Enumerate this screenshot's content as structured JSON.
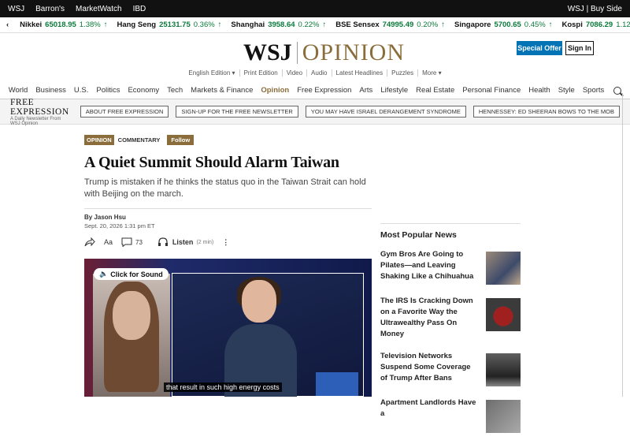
{
  "topbar": {
    "brands": [
      "WSJ",
      "Barron's",
      "MarketWatch",
      "IBD"
    ],
    "right": "WSJ | Buy Side"
  },
  "ticker": [
    {
      "name": "Nikkei",
      "value": "65018.95",
      "pct": "1.38%"
    },
    {
      "name": "Hang Seng",
      "value": "25131.75",
      "pct": "0.36%"
    },
    {
      "name": "Shanghai",
      "value": "3958.64",
      "pct": "0.22%"
    },
    {
      "name": "BSE Sensex",
      "value": "74995.49",
      "pct": "0.20%"
    },
    {
      "name": "Singapore",
      "value": "5700.65",
      "pct": "0.45%"
    },
    {
      "name": "Kospi",
      "value": "7086.29",
      "pct": "1.12%"
    }
  ],
  "header": {
    "logo_wsj": "WSJ",
    "logo_section": "OPINION",
    "special_offer": "Special Offer",
    "sign_in": "Sign In"
  },
  "subnav": [
    "English Edition ▾",
    "Print Edition",
    "Video",
    "Audio",
    "Latest Headlines",
    "Puzzles",
    "More ▾"
  ],
  "mainnav": [
    "World",
    "Business",
    "U.S.",
    "Politics",
    "Economy",
    "Tech",
    "Markets & Finance",
    "Opinion",
    "Free Expression",
    "Arts",
    "Lifestyle",
    "Real Estate",
    "Personal Finance",
    "Health",
    "Style",
    "Sports"
  ],
  "free_expression": {
    "title": "FREE EXPRESSION",
    "subtitle": "A Daily Newsletter From WSJ Opinion",
    "links": [
      "ABOUT FREE EXPRESSION",
      "SIGN-UP FOR THE FREE NEWSLETTER",
      "YOU MAY HAVE ISRAEL DERANGEMENT SYNDROME",
      "HENNESSEY: ED SHEERAN BOWS TO THE MOB"
    ]
  },
  "article": {
    "tag_opinion": "OPINION",
    "tag_commentary": "COMMENTARY",
    "follow": "Follow",
    "headline": "A Quiet Summit Should Alarm Taiwan",
    "dek": "Trump is mistaken if he thinks the status quo in the Taiwan Strait can hold with Beijing on the march.",
    "byline": "By Jason Hsu",
    "date": "Sept. 20, 2026 1:31 pm ET",
    "comments": "73",
    "listen": "Listen",
    "listen_duration": "(2 min)",
    "font_size_label": "Aa"
  },
  "video": {
    "sound_button": "Click for Sound",
    "caption": "that result in such high energy costs"
  },
  "sidebar": {
    "title": "Most Popular News",
    "items": [
      "Gym Bros Are Going to Pilates—and Leaving Shaking Like a Chihuahua",
      "The IRS Is Cracking Down on a Favorite Way the Ultrawealthy Pass On Money",
      "Television Networks Suspend Some Coverage of Trump After Bans",
      "Apartment Landlords Have a"
    ]
  }
}
